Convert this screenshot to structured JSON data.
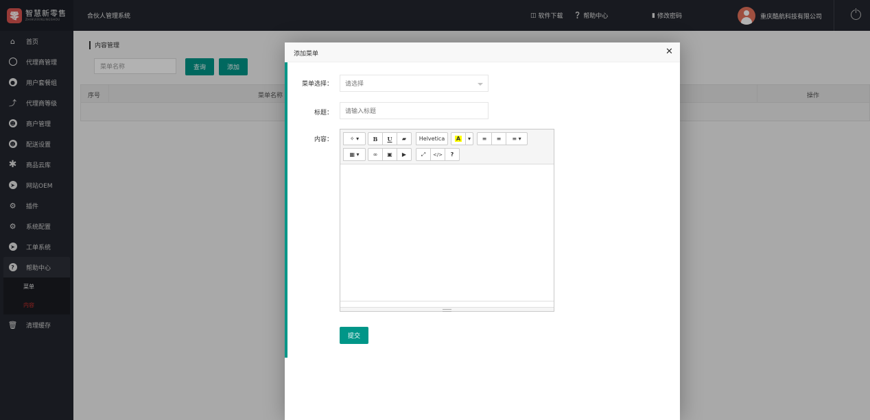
{
  "brand": {
    "logo_char": "零",
    "name_cn": "智慧新零售",
    "name_en": "ZHIHUIXINLINGSHOU"
  },
  "header": {
    "system_title": "合伙人管理系统",
    "links": [
      {
        "label": "软件下载",
        "icon": "download-icon"
      },
      {
        "label": "帮助中心",
        "icon": "help-circle-icon"
      },
      {
        "label": "修改密码",
        "icon": "key-icon"
      }
    ],
    "company": "重庆酷航科技有限公司"
  },
  "sidebar": {
    "items": [
      {
        "label": "首页",
        "icon": "home-icon"
      },
      {
        "label": "代理商管理",
        "icon": "agent-icon"
      },
      {
        "label": "用户套餐组",
        "icon": "package-icon"
      },
      {
        "label": "代理商等级",
        "icon": "level-icon"
      },
      {
        "label": "商户管理",
        "icon": "merchant-icon"
      },
      {
        "label": "配送设置",
        "icon": "delivery-icon"
      },
      {
        "label": "商品云库",
        "icon": "asterisk-icon"
      },
      {
        "label": "网站OEM",
        "icon": "send-icon"
      },
      {
        "label": "插件",
        "icon": "cogs-icon"
      },
      {
        "label": "系统配置",
        "icon": "cogs-icon"
      },
      {
        "label": "工单系统",
        "icon": "send-icon"
      },
      {
        "label": "帮助中心",
        "icon": "question-icon"
      }
    ],
    "help_sub": [
      {
        "label": "菜单"
      },
      {
        "label": "内容"
      }
    ],
    "clear_cache": "清理缓存"
  },
  "main": {
    "breadcrumb": "内容管理",
    "search_placeholder": "菜单名称",
    "query_button": "查询",
    "add_button": "添加",
    "table": {
      "columns": [
        "序号",
        "菜单名称",
        "操作"
      ]
    }
  },
  "modal": {
    "title": "添加菜单",
    "menu_label": "菜单选择：",
    "menu_placeholder": "请选择",
    "title_label": "标题：",
    "title_placeholder": "请输入标题",
    "content_label": "内容：",
    "font_name": "Helvetica",
    "submit_label": "提交"
  },
  "colors": {
    "accent": "#009688",
    "topbar": "#23262e",
    "active_sub": "#c9302c"
  }
}
